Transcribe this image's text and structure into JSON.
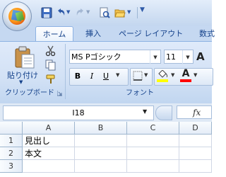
{
  "ribbon": {
    "tabs": [
      {
        "label": "ホーム",
        "active": true
      },
      {
        "label": "挿入"
      },
      {
        "label": "ページ レイアウト"
      },
      {
        "label": "数式"
      }
    ],
    "clipboard": {
      "paste_label": "貼り付け",
      "group_label": "クリップボード"
    },
    "font": {
      "font_name": "MS Pゴシック",
      "font_size": "11",
      "bold": "B",
      "italic": "I",
      "underline": "U",
      "font_color_glyph": "A",
      "group_label": "フォント"
    }
  },
  "formula_bar": {
    "name_box": "I18",
    "fx": "fx",
    "formula": ""
  },
  "sheet": {
    "columns": [
      "A",
      "B",
      "C",
      "D"
    ],
    "rows": [
      {
        "number": "1",
        "cells": [
          "見出し",
          "",
          "",
          ""
        ]
      },
      {
        "number": "2",
        "cells": [
          "本文",
          "",
          "",
          ""
        ]
      },
      {
        "number": "3",
        "cells": [
          "",
          "",
          "",
          ""
        ]
      }
    ]
  },
  "colors": {
    "highlight_swatch": "#ffff00",
    "font_color_swatch": "#ff0000",
    "tab_text": "#15428b"
  }
}
